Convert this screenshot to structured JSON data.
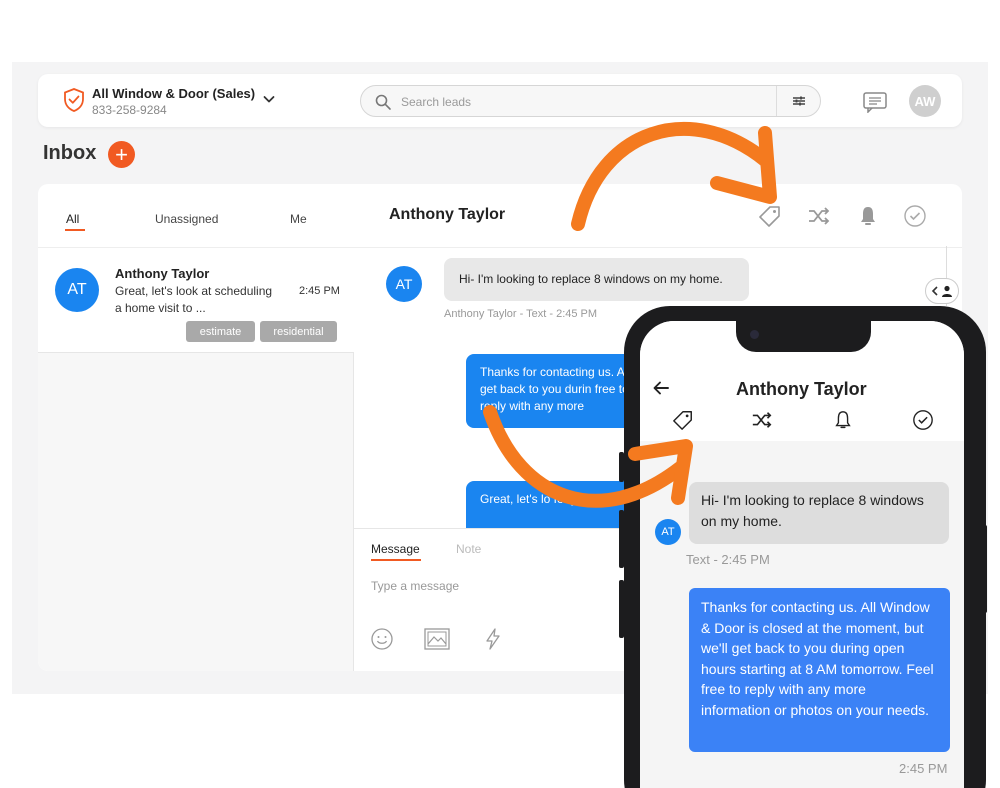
{
  "org": {
    "name": "All Window & Door (Sales)",
    "phone": "833-258-9284"
  },
  "search": {
    "placeholder": "Search leads"
  },
  "user": {
    "initials": "AW"
  },
  "inbox": {
    "title": "Inbox",
    "add_label": "+"
  },
  "tabs": [
    {
      "label": "All"
    },
    {
      "label": "Unassigned"
    },
    {
      "label": "Me"
    }
  ],
  "conversation": {
    "title": "Anthony Taylor"
  },
  "list": [
    {
      "initials": "AT",
      "name": "Anthony Taylor",
      "preview": "Great, let's look at scheduling a home visit to ...",
      "time": "2:45 PM",
      "tags": [
        "estimate",
        "residential"
      ]
    }
  ],
  "thread": {
    "initials": "AT",
    "incoming": "Hi- I'm looking to replace 8 windows on my home.",
    "incoming_meta": "Anthony Taylor - Text - 2:45 PM",
    "outgoing_1": "Thanks for contacting us. A we'll get back to you durin free to reply with any more",
    "outgoing_2": "Great, let's lo for your project."
  },
  "compose": {
    "tab_message": "Message",
    "tab_note": "Note",
    "placeholder": "Type a message"
  },
  "mobile": {
    "title": "Anthony Taylor",
    "initials": "AT",
    "incoming": "Hi- I'm looking to replace 8 windows on my home.",
    "incoming_meta": "Text - 2:45 PM",
    "outgoing": "Thanks for contacting us. All Window & Door is closed at the moment, but we'll get back to you during open hours starting at 8 AM tomorrow. Feel free to reply with any more information or photos on your needs.",
    "outgoing_time": "2:45 PM"
  },
  "colors": {
    "accent": "#f15a22",
    "primary_blue": "#1a85f0",
    "arrow": "#f47a1f"
  }
}
